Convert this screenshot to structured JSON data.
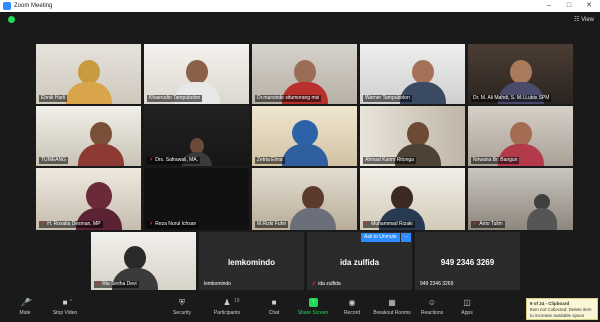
{
  "window": {
    "title": "Zoom Meeting"
  },
  "top": {
    "view_label": "View"
  },
  "participants": [
    {
      "name": "Ehnik Harli",
      "muted": false
    },
    {
      "name": "Khaerudin Tampubolon",
      "muted": false
    },
    {
      "name": "Dr.marsinde situmorang msi",
      "muted": false
    },
    {
      "name": "Warner Tampubolon",
      "muted": false
    },
    {
      "name": "Dr. M. Ali Mahdi, S. M.I.Lubis SPM",
      "muted": false
    },
    {
      "name": "TUMEANG",
      "muted": false
    },
    {
      "name": "Drs. Safrawali, MA.",
      "muted": true
    },
    {
      "name": "Zetria Elma",
      "muted": false
    },
    {
      "name": "Ahmad Karim Ritonga",
      "muted": false
    },
    {
      "name": "Nirwana Br. Bangun",
      "muted": false
    },
    {
      "name": "H. Rosalia Desman, MP",
      "muted": true
    },
    {
      "name": "Reza Nurul Ichsan",
      "muted": true
    },
    {
      "name": "M.Rizki Fuhri",
      "muted": false
    },
    {
      "name": "Muhammad Rizaki",
      "muted": true
    },
    {
      "name": "Anto Tulim",
      "muted": true
    },
    {
      "name": "Ria Sintha Devi",
      "muted": true
    },
    {
      "name": "lemkomindo",
      "muted": false,
      "big": "lemkomindo"
    },
    {
      "name": "ida zulfida",
      "muted": true,
      "big": "ida zulfida"
    },
    {
      "name": "949 2346 3269",
      "muted": false,
      "big": "949 2346 3269"
    }
  ],
  "ask_unmute_label": "Ask to Unmute",
  "toolbar": {
    "mute": "Mute",
    "stop_video": "Stop Video",
    "security": "Security",
    "participants": "Participants",
    "participants_count": "19",
    "chat": "Chat",
    "share_screen": "Share Screen",
    "record": "Record",
    "breakout_rooms": "Breakout Rooms",
    "reactions": "Reactions",
    "apps": "Apps"
  },
  "clipboard": {
    "title": "9 of 24 - Clipboard",
    "line1": "Item not Collected: Delete item",
    "line2": "to increase available space"
  },
  "colors": {
    "active_speaker": "#c8e635",
    "zoom_blue": "#2d8cff",
    "share_green": "#23d959",
    "muted_red": "#e02828"
  }
}
